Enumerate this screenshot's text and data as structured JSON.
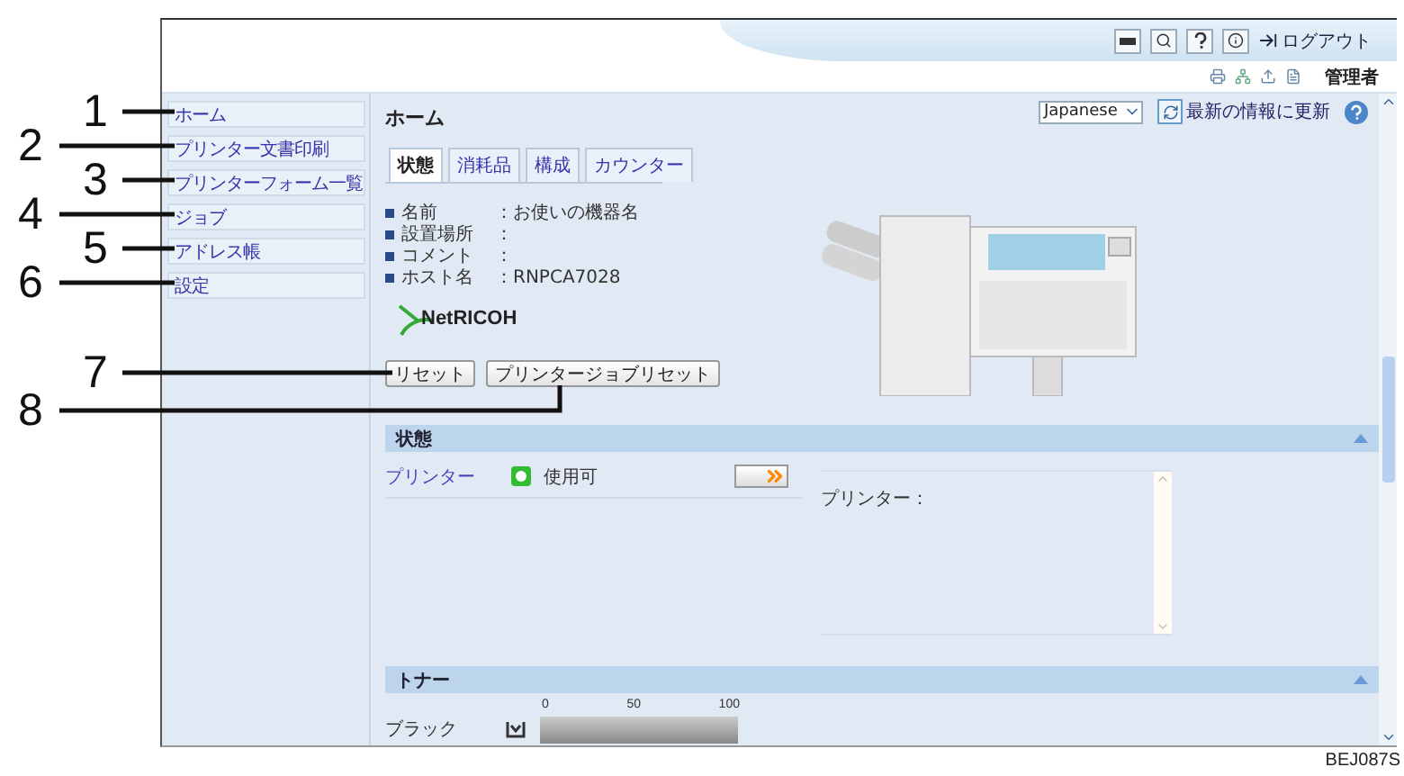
{
  "callouts": [
    {
      "label": "1"
    },
    {
      "label": "2"
    },
    {
      "label": "3"
    },
    {
      "label": "4"
    },
    {
      "label": "5"
    },
    {
      "label": "6"
    },
    {
      "label": "7"
    },
    {
      "label": "8"
    }
  ],
  "header": {
    "logout": "ログアウト",
    "user": "管理者"
  },
  "sidebar": {
    "items": [
      {
        "label": "ホーム"
      },
      {
        "label": "プリンター文書印刷"
      },
      {
        "label": "プリンターフォーム一覧"
      },
      {
        "label": "ジョブ"
      },
      {
        "label": "アドレス帳"
      },
      {
        "label": "設定"
      }
    ]
  },
  "content": {
    "title": "ホーム",
    "language": "Japanese",
    "refresh": "最新の情報に更新",
    "tabs": [
      {
        "label": "状態",
        "selected": true
      },
      {
        "label": "消耗品",
        "selected": false
      },
      {
        "label": "構成",
        "selected": false
      },
      {
        "label": "カウンター",
        "selected": false
      }
    ],
    "info": [
      {
        "label": "名前",
        "value": "：お使いの機器名"
      },
      {
        "label": "設置場所",
        "value": "："
      },
      {
        "label": "コメント",
        "value": "："
      },
      {
        "label": "ホスト名",
        "value": "：RNPCA7028"
      }
    ],
    "logo": "NetRICOH",
    "buttons": [
      "リセット",
      "プリンタージョブリセット"
    ]
  },
  "status_section": {
    "title": "状態",
    "device": "プリンター",
    "status": "使用可",
    "message_label": "プリンター："
  },
  "toner_section": {
    "title": "トナー",
    "ticks": [
      "0",
      "50",
      "100"
    ],
    "color_name": "ブラック",
    "level": 1
  },
  "figure_code": "BEJ087S"
}
